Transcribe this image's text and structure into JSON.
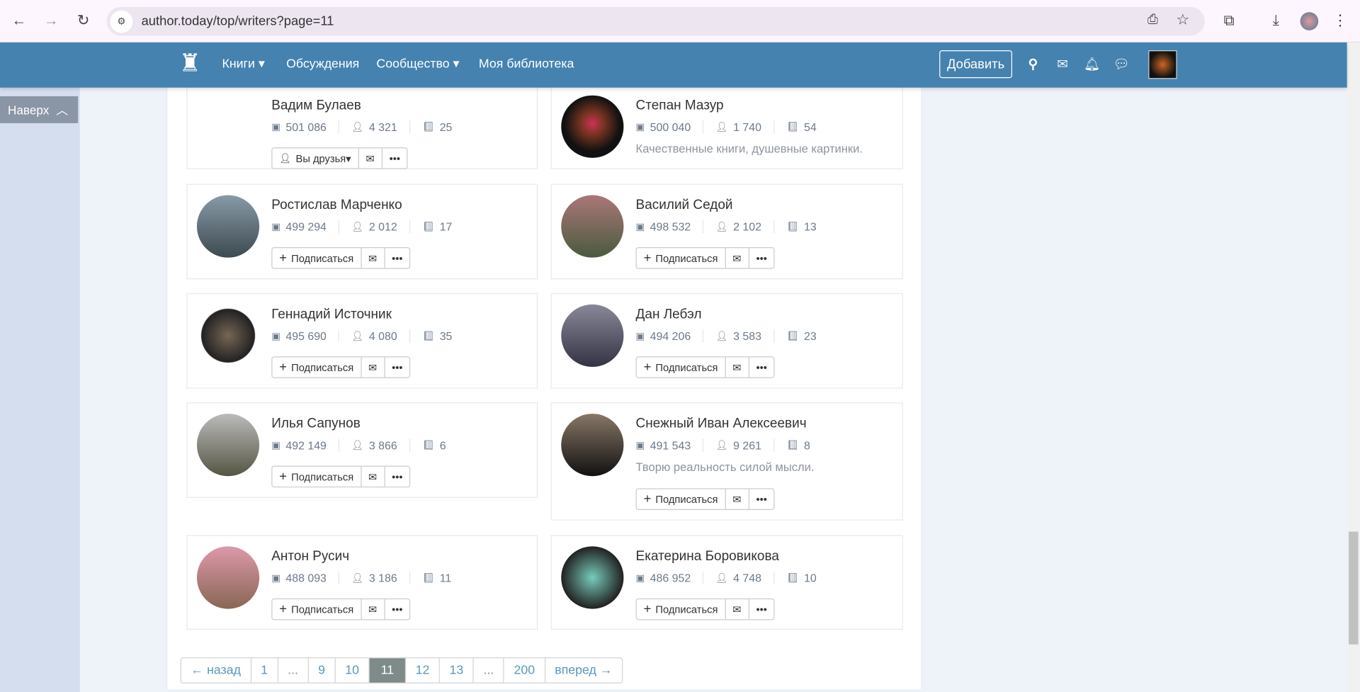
{
  "browser": {
    "url": "author.today/top/writers?page=11"
  },
  "nav": {
    "links": [
      "Книги",
      "Обсуждения",
      "Сообщество",
      "Моя библиотека"
    ],
    "add_label": "Добавить"
  },
  "to_top": "Наверх",
  "colors": {
    "nav": "#4582af",
    "pager_active": "#7f8b8a"
  },
  "writers": [
    {
      "name": "Вадим Булаев",
      "views": "501 086",
      "followers": "4 321",
      "books": "25",
      "button": "Вы друзья",
      "friend": true
    },
    {
      "name": "Степан Мазур",
      "views": "500 040",
      "followers": "1 740",
      "books": "54",
      "about": "Качественные книги, душевные картинки."
    },
    {
      "name": "Ростислав Марченко",
      "views": "499 294",
      "followers": "2 012",
      "books": "17",
      "button": "Подписаться"
    },
    {
      "name": "Василий Седой",
      "views": "498 532",
      "followers": "2 102",
      "books": "13",
      "button": "Подписаться"
    },
    {
      "name": "Геннадий Источник",
      "views": "495 690",
      "followers": "4 080",
      "books": "35",
      "button": "Подписаться"
    },
    {
      "name": "Дан Лебэл",
      "views": "494 206",
      "followers": "3 583",
      "books": "23",
      "button": "Подписаться"
    },
    {
      "name": "Илья Сапунов",
      "views": "492 149",
      "followers": "3 866",
      "books": "6",
      "button": "Подписаться"
    },
    {
      "name": "Снежный Иван Алексеевич",
      "views": "491 543",
      "followers": "9 261",
      "books": "8",
      "about": "Творю реальность силой мысли.",
      "button": "Подписаться"
    },
    {
      "name": "Антон Русич",
      "views": "488 093",
      "followers": "3 186",
      "books": "11",
      "button": "Подписаться"
    },
    {
      "name": "Екатерина Боровикова",
      "views": "486 952",
      "followers": "4 748",
      "books": "10",
      "button": "Подписаться"
    }
  ],
  "pagination": {
    "prev": "← назад",
    "pages": [
      "1",
      "...",
      "9",
      "10",
      "11",
      "12",
      "13",
      "...",
      "200"
    ],
    "current": "11",
    "next": "вперед →"
  }
}
